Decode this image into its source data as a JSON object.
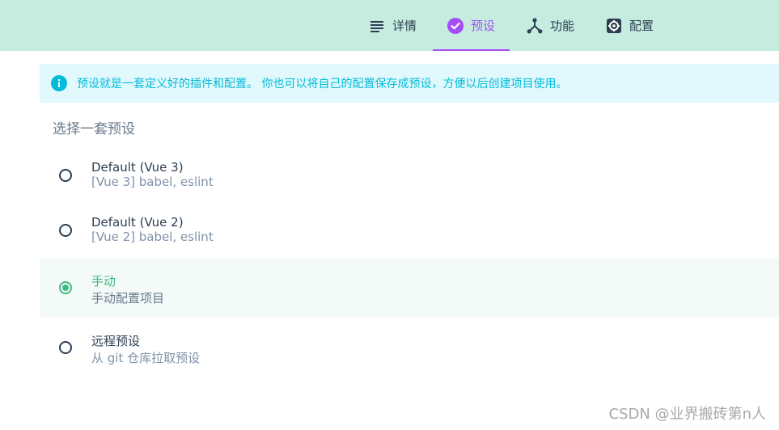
{
  "tabs": [
    {
      "label": "详情",
      "icon": "details-list-icon"
    },
    {
      "label": "预设",
      "icon": "check-circle-icon"
    },
    {
      "label": "功能",
      "icon": "fork-icon"
    },
    {
      "label": "配置",
      "icon": "gear-icon"
    }
  ],
  "active_tab": "预设",
  "info_banner": {
    "text": "预设就是一套定义好的插件和配置。 你也可以将自己的配置保存成预设，方便以后创建项目使用。",
    "icon": "info-icon"
  },
  "section_title": "选择一套预设",
  "presets": [
    {
      "name": "Default (Vue 3)",
      "description": "[Vue 3] babel, eslint",
      "selected": false
    },
    {
      "name": "Default (Vue 2)",
      "description": "[Vue 2] babel, eslint",
      "selected": false
    },
    {
      "name": "手动",
      "description": "手动配置项目",
      "selected": true
    },
    {
      "name": "远程预设",
      "description": "从 git 仓库拉取预设",
      "selected": false
    }
  ],
  "watermark": "CSDN @业界搬砖第n人",
  "colors": {
    "topbar_bg": "#c6ece0",
    "active_tab": "#a44cf6",
    "info_bg": "#e1f8fc",
    "info_text": "#03bcd9",
    "selected_green": "#42b983",
    "selected_row_bg": "#f3faf8"
  }
}
